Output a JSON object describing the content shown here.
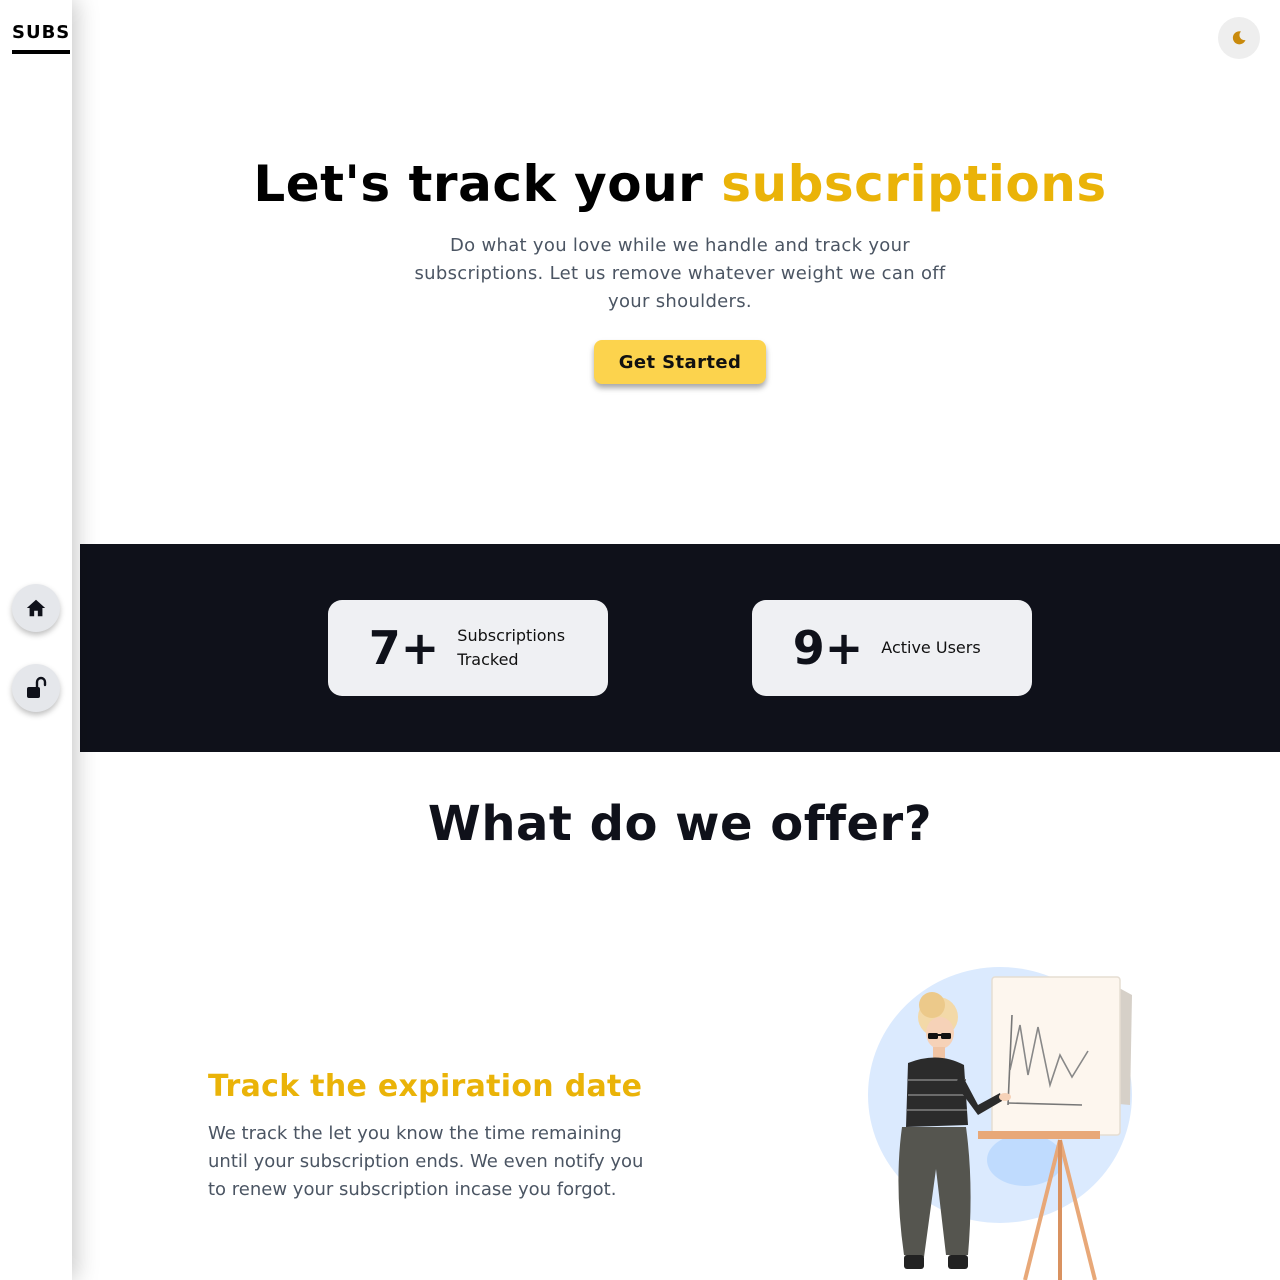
{
  "sidebar": {
    "brand": "SUBS",
    "nav": [
      {
        "name": "home",
        "icon": "home-icon"
      },
      {
        "name": "login",
        "icon": "unlock-icon"
      }
    ]
  },
  "header": {
    "theme_toggle_icon": "moon-icon"
  },
  "hero": {
    "title_main": "Let's track your ",
    "title_accent": "subscriptions",
    "subtitle": "Do what you love while we handle and track your subscriptions. Let us remove whatever weight we can off your shoulders.",
    "cta_label": "Get Started"
  },
  "stats": [
    {
      "value": "7+",
      "label": "Subscriptions Tracked"
    },
    {
      "value": "9+",
      "label": "Active Users"
    }
  ],
  "offer": {
    "title": "What do we offer?",
    "features": [
      {
        "title": "Track the expiration date",
        "description": "We track the let you know the time remaining until your subscription ends. We even notify you to renew your subscription incase you forgot.",
        "illustration": "woman-presenting-chart-illustration"
      }
    ]
  },
  "colors": {
    "accent": "#eab308",
    "button": "#fcd34d",
    "dark_band": "#0f111a",
    "card": "#eff0f3",
    "muted_text": "#4b5563"
  }
}
